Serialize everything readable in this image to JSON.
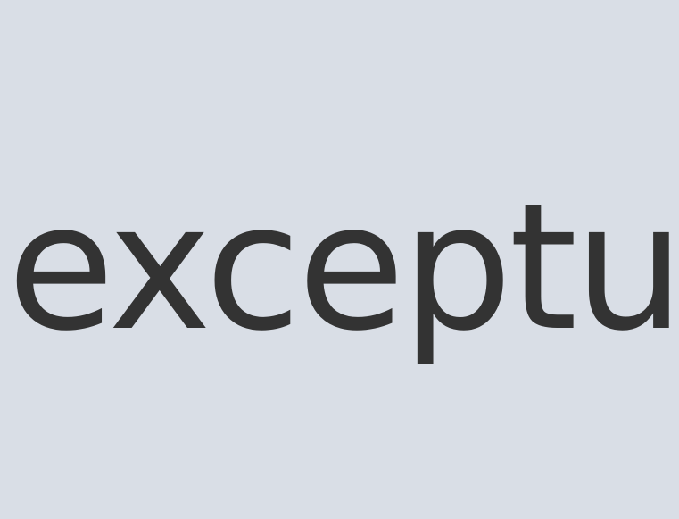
{
  "display": {
    "text": "excepturi"
  }
}
